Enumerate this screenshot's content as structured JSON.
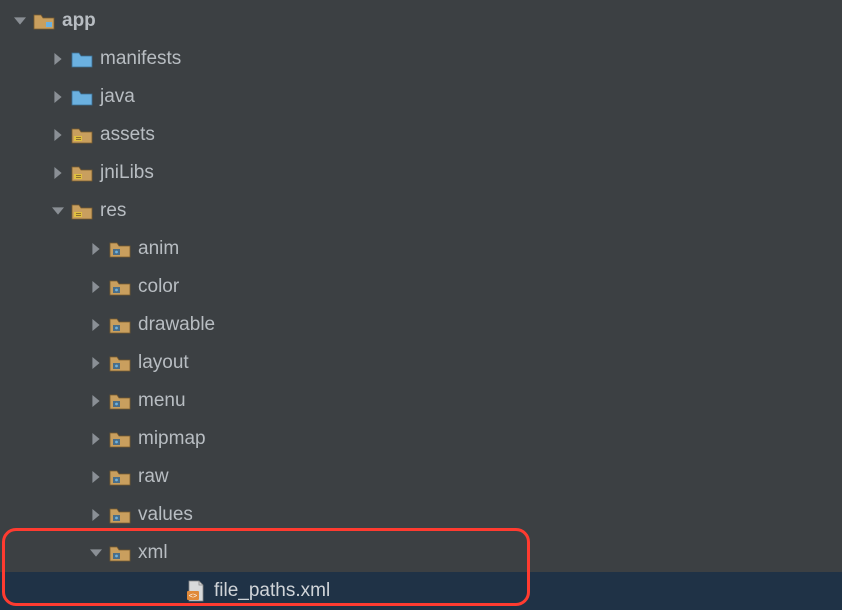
{
  "tree": [
    {
      "indent": 8,
      "arrow": "down",
      "icon": "module-folder",
      "label": "app",
      "bold": true,
      "selected": false
    },
    {
      "indent": 46,
      "arrow": "right",
      "icon": "folder-plain",
      "label": "manifests",
      "bold": false,
      "selected": false
    },
    {
      "indent": 46,
      "arrow": "right",
      "icon": "folder-plain",
      "label": "java",
      "bold": false,
      "selected": false
    },
    {
      "indent": 46,
      "arrow": "right",
      "icon": "folder-special",
      "label": "assets",
      "bold": false,
      "selected": false
    },
    {
      "indent": 46,
      "arrow": "right",
      "icon": "folder-special",
      "label": "jniLibs",
      "bold": false,
      "selected": false
    },
    {
      "indent": 46,
      "arrow": "down",
      "icon": "folder-special",
      "label": "res",
      "bold": false,
      "selected": false
    },
    {
      "indent": 84,
      "arrow": "right",
      "icon": "folder-res",
      "label": "anim",
      "bold": false,
      "selected": false
    },
    {
      "indent": 84,
      "arrow": "right",
      "icon": "folder-res",
      "label": "color",
      "bold": false,
      "selected": false
    },
    {
      "indent": 84,
      "arrow": "right",
      "icon": "folder-res",
      "label": "drawable",
      "bold": false,
      "selected": false
    },
    {
      "indent": 84,
      "arrow": "right",
      "icon": "folder-res",
      "label": "layout",
      "bold": false,
      "selected": false
    },
    {
      "indent": 84,
      "arrow": "right",
      "icon": "folder-res",
      "label": "menu",
      "bold": false,
      "selected": false
    },
    {
      "indent": 84,
      "arrow": "right",
      "icon": "folder-res",
      "label": "mipmap",
      "bold": false,
      "selected": false
    },
    {
      "indent": 84,
      "arrow": "right",
      "icon": "folder-res",
      "label": "raw",
      "bold": false,
      "selected": false
    },
    {
      "indent": 84,
      "arrow": "right",
      "icon": "folder-res",
      "label": "values",
      "bold": false,
      "selected": false
    },
    {
      "indent": 84,
      "arrow": "down",
      "icon": "folder-res",
      "label": "xml",
      "bold": false,
      "selected": false
    },
    {
      "indent": 160,
      "arrow": "none",
      "icon": "file-xml",
      "label": "file_paths.xml",
      "bold": false,
      "selected": true
    }
  ]
}
